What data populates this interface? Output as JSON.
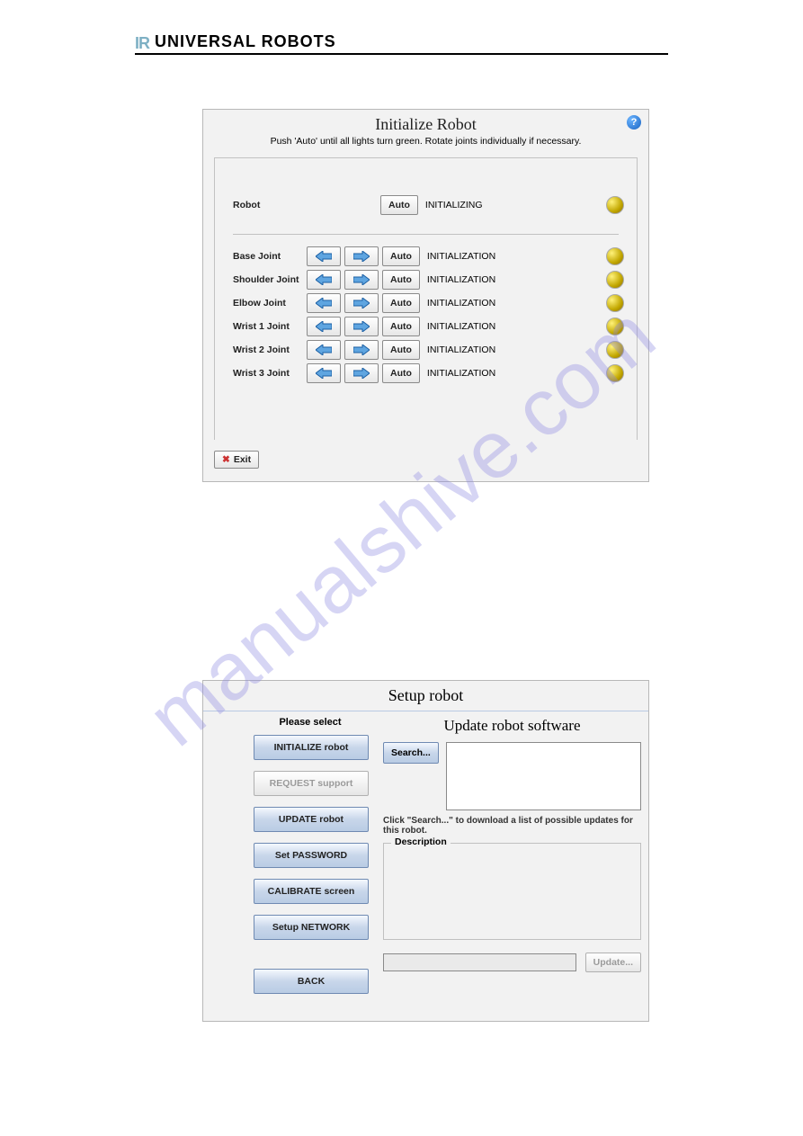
{
  "header": {
    "brand": "UNIVERSAL ROBOTS"
  },
  "watermark": "manualshive.com",
  "init_panel": {
    "title": "Initialize Robot",
    "subtitle": "Push 'Auto' until all lights turn green. Rotate joints individually if necessary.",
    "robot_label": "Robot",
    "auto_label": "Auto",
    "robot_status": "INITIALIZING",
    "joints": [
      {
        "label": "Base Joint",
        "auto": "Auto",
        "status": "INITIALIZATION"
      },
      {
        "label": "Shoulder Joint",
        "auto": "Auto",
        "status": "INITIALIZATION"
      },
      {
        "label": "Elbow Joint",
        "auto": "Auto",
        "status": "INITIALIZATION"
      },
      {
        "label": "Wrist 1 Joint",
        "auto": "Auto",
        "status": "INITIALIZATION"
      },
      {
        "label": "Wrist 2 Joint",
        "auto": "Auto",
        "status": "INITIALIZATION"
      },
      {
        "label": "Wrist 3 Joint",
        "auto": "Auto",
        "status": "INITIALIZATION"
      }
    ],
    "exit_label": "Exit"
  },
  "setup_panel": {
    "title": "Setup robot",
    "subtitle": "Update robot software",
    "please_select": "Please select",
    "buttons": {
      "initialize": "INITIALIZE robot",
      "request": "REQUEST support",
      "update": "UPDATE robot",
      "password": "Set PASSWORD",
      "calibrate": "CALIBRATE screen",
      "network": "Setup NETWORK",
      "back": "BACK"
    },
    "search_label": "Search...",
    "search_hint": "Click \"Search...\" to download a list of possible updates for this robot.",
    "description_label": "Description",
    "update_btn": "Update..."
  }
}
